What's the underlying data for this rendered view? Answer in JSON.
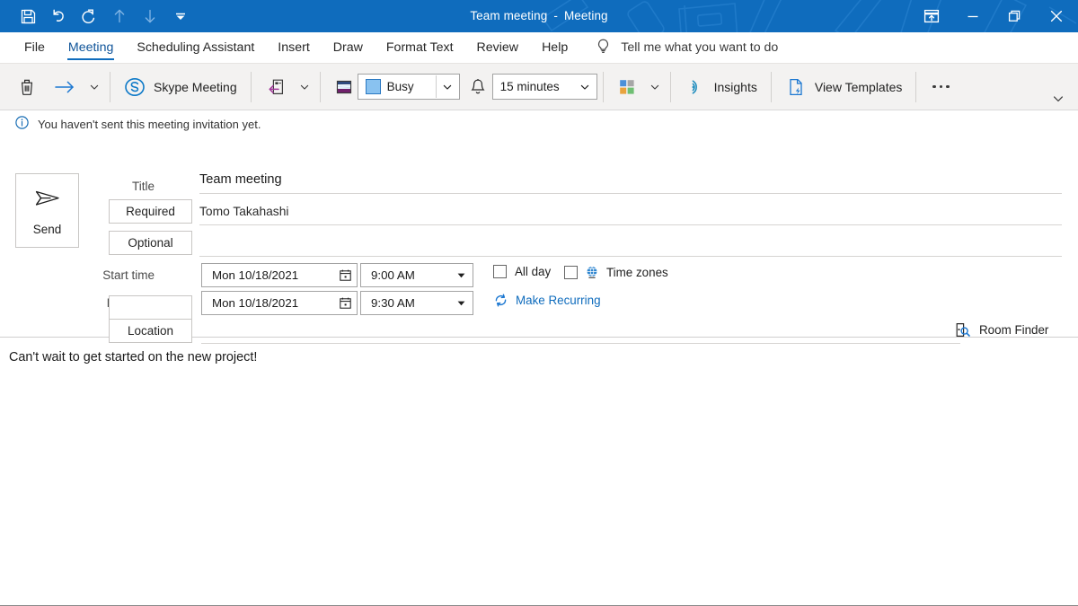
{
  "titlebar": {
    "title_main": "Team meeting",
    "title_sep": "-",
    "title_type": "Meeting",
    "accent_color": "#0f6cbd",
    "quick_access": [
      {
        "name": "save-icon",
        "label": "Save"
      },
      {
        "name": "undo-icon",
        "label": "Undo"
      },
      {
        "name": "redo-icon",
        "label": "Redo"
      },
      {
        "name": "previous-item-icon",
        "label": "Previous Item"
      },
      {
        "name": "next-item-icon",
        "label": "Next Item"
      },
      {
        "name": "customize-quick-access-toolbar-icon",
        "label": "Customize Quick Access Toolbar"
      }
    ],
    "window_controls": [
      {
        "name": "ribbon-display-options-icon",
        "label": "Ribbon Display Options"
      },
      {
        "name": "minimize-icon",
        "label": "Minimize"
      },
      {
        "name": "restore-icon",
        "label": "Restore Down"
      },
      {
        "name": "close-icon",
        "label": "Close"
      }
    ]
  },
  "tabs": [
    {
      "label": "File",
      "active": false
    },
    {
      "label": "Meeting",
      "active": true
    },
    {
      "label": "Scheduling Assistant",
      "active": false
    },
    {
      "label": "Insert",
      "active": false
    },
    {
      "label": "Draw",
      "active": false
    },
    {
      "label": "Format Text",
      "active": false
    },
    {
      "label": "Review",
      "active": false
    },
    {
      "label": "Help",
      "active": false
    }
  ],
  "tell_me": {
    "icon": "lightbulb-icon",
    "label": "Tell me what you want to do"
  },
  "ribbon": {
    "delete_icon": "trash-icon",
    "forward_icon": "forward-arrow-icon",
    "skype_meeting_label": "Skype Meeting",
    "skype_icon": "skype-icon",
    "response_options_icon": "response-options-icon",
    "show_as_icon": "show-as-icon",
    "show_as_value": "Busy",
    "show_as_color": "#89c2f0",
    "reminder_icon": "bell-icon",
    "reminder_value": "15 minutes",
    "categorize_icon": "categorize-grid-icon",
    "insights_label": "Insights",
    "insights_icon": "insights-icon",
    "view_templates_label": "View Templates",
    "view_templates_icon": "view-templates-icon",
    "more_commands_label": "More commands",
    "collapse_ribbon_label": "Collapse the Ribbon"
  },
  "infobar": {
    "icon": "info-icon",
    "message": "You haven't sent this meeting invitation yet."
  },
  "form": {
    "send_label": "Send",
    "send_icon": "send-paper-plane-icon",
    "title_label": "Title",
    "title_value": "Team meeting",
    "required_label": "Required",
    "required_value": "Tomo Takahashi",
    "optional_label": "Optional",
    "optional_value": "",
    "start_time_label": "Start time",
    "start_date_value": "Mon 10/18/2021",
    "start_time_value": "9:00 AM",
    "end_time_label": "End time",
    "end_date_value": "Mon 10/18/2021",
    "end_time_value": "9:30 AM",
    "calendar_icon": "calendar-picker-icon",
    "all_day_label": "All day",
    "all_day_checked": false,
    "time_zones_label": "Time zones",
    "time_zones_checked": false,
    "time_zones_icon": "globe-icon",
    "make_recurring_label": "Make Recurring",
    "make_recurring_icon": "recurrence-icon",
    "location_label": "Location",
    "location_value": "",
    "room_finder_label": "Room Finder",
    "room_finder_icon": "room-finder-icon"
  },
  "body": {
    "text": "Can't wait to get started on the new project!"
  }
}
